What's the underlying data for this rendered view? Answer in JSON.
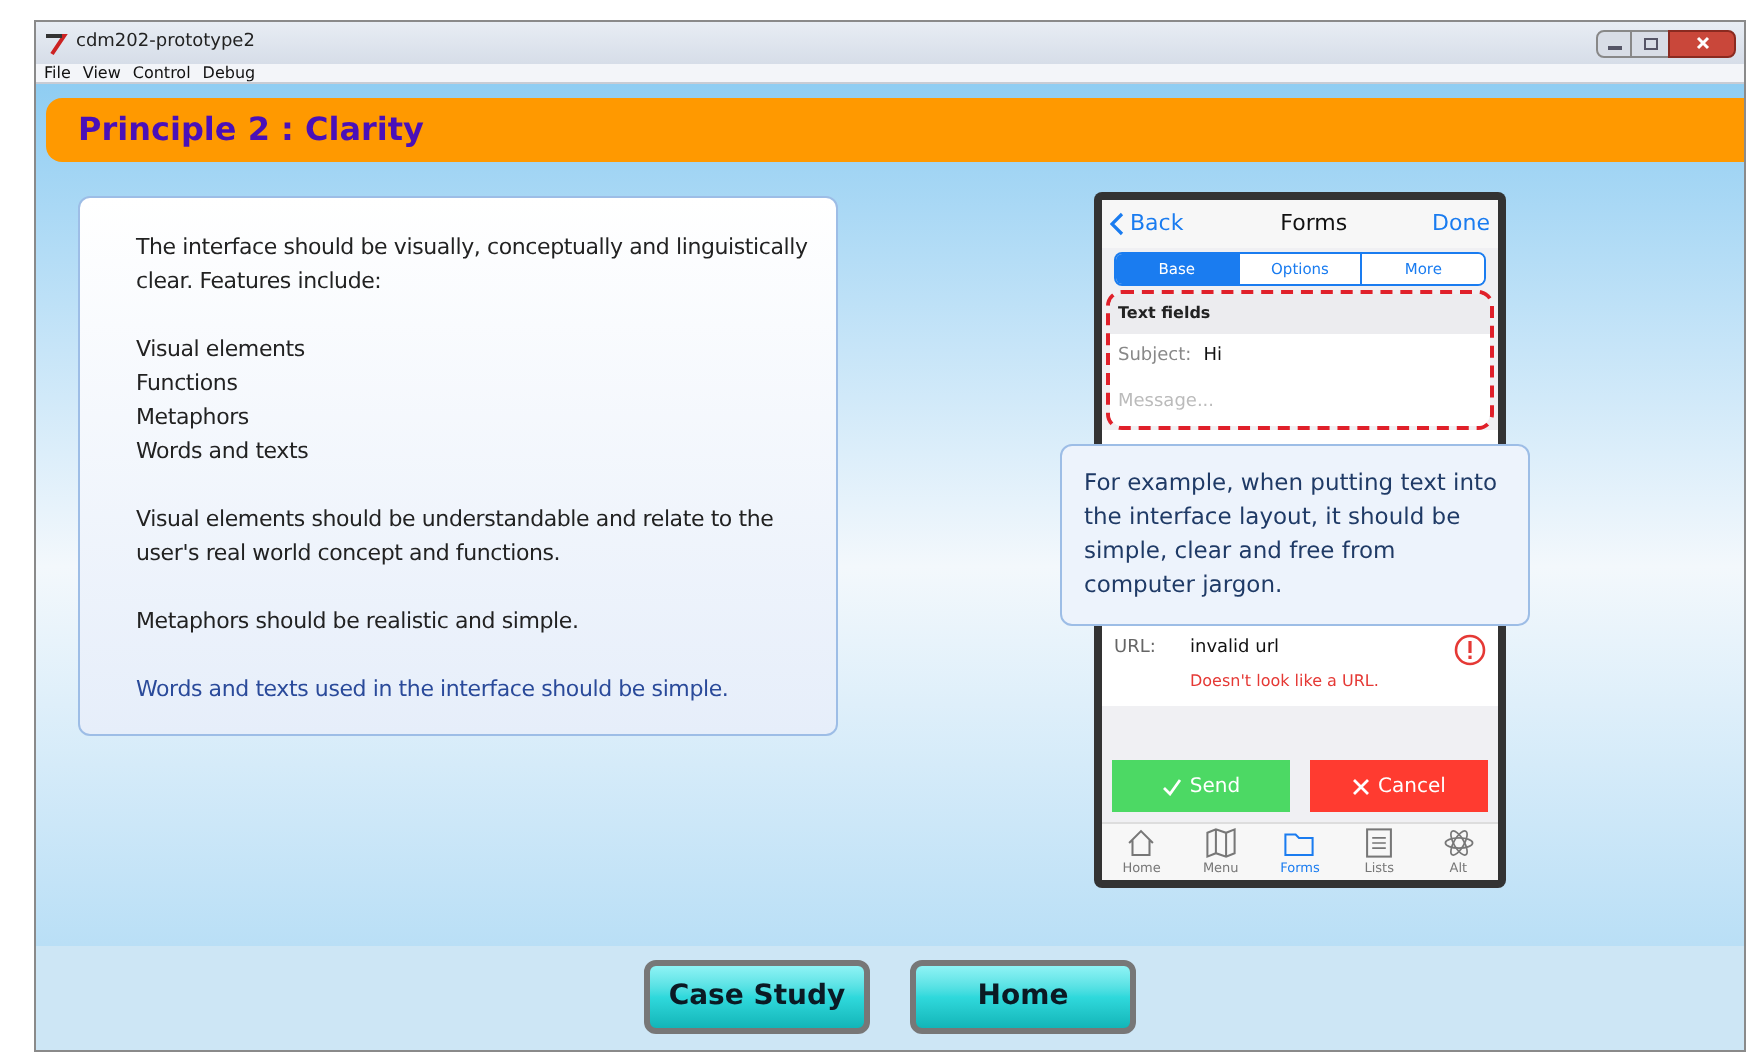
{
  "window": {
    "title": "cdm202-prototype2"
  },
  "menu": [
    "File",
    "View",
    "Control",
    "Debug"
  ],
  "header": {
    "title": "Principle 2 : Clarity"
  },
  "card": {
    "intro": "The interface should be visually, conceptually and linguistically clear. Features include:",
    "features": [
      "Visual elements",
      "Functions",
      "Metaphors",
      "Words and texts"
    ],
    "paragraphs": [
      {
        "text": "Visual elements should be understandable and relate to the user's real world concept and functions.",
        "highlight": false
      },
      {
        "text": "Metaphors should be realistic and simple.",
        "highlight": false
      },
      {
        "text": "Words and texts used in the interface should be simple.",
        "highlight": true
      }
    ]
  },
  "phone": {
    "back": "Back",
    "title": "Forms",
    "done": "Done",
    "segments": [
      {
        "label": "Base",
        "selected": true
      },
      {
        "label": "Options",
        "selected": false
      },
      {
        "label": "More",
        "selected": false
      }
    ],
    "section": "Text fields",
    "subject_label": "Subject:",
    "subject_value": "Hi",
    "message_placeholder": "Message...",
    "url_label": "URL:",
    "url_value": "invalid url",
    "url_error": "Doesn't look like a URL.",
    "send": "Send",
    "cancel": "Cancel",
    "tabs": [
      {
        "label": "Home",
        "kind": "home",
        "selected": false
      },
      {
        "label": "Menu",
        "kind": "map",
        "selected": false
      },
      {
        "label": "Forms",
        "kind": "folder",
        "selected": true
      },
      {
        "label": "Lists",
        "kind": "list",
        "selected": false
      },
      {
        "label": "Alt",
        "kind": "atom",
        "selected": false
      }
    ]
  },
  "callout": "For example, when putting text into the interface layout, it should be simple, clear and free from computer jargon.",
  "buttons": [
    "Case Study",
    "Home"
  ]
}
